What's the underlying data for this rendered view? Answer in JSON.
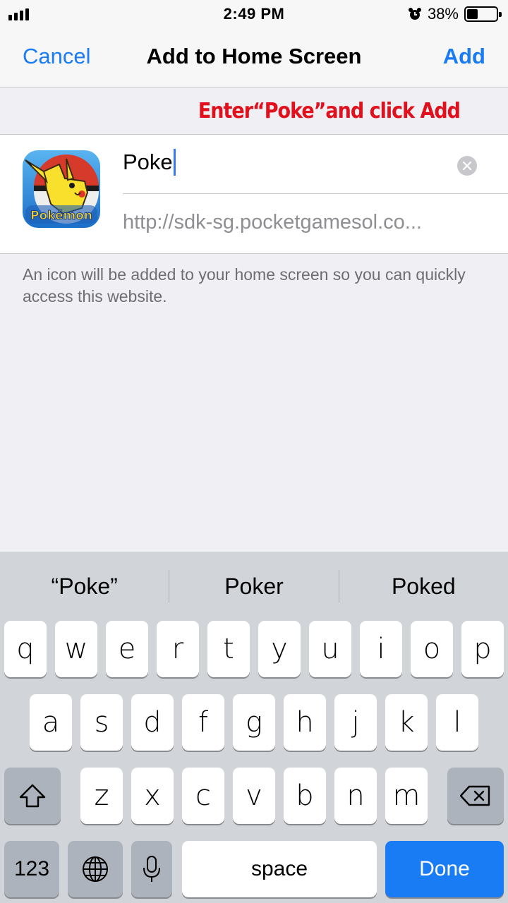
{
  "status_bar": {
    "time": "2:49 PM",
    "battery_percent": "38%",
    "battery_level": 0.38
  },
  "nav": {
    "cancel_label": "Cancel",
    "title": "Add to Home Screen",
    "add_label": "Add"
  },
  "annotation": "Enter“Poke”and click Add",
  "form": {
    "name_value": "Poke",
    "url": "http://sdk-sg.pocketgamesol.co...",
    "icon": "pokemon-pikachu-app-icon"
  },
  "footnote": "An icon will be added to your home screen so you can quickly access this website.",
  "keyboard": {
    "predictions": [
      "“Poke”",
      "Poker",
      "Poked"
    ],
    "row1": [
      "q",
      "w",
      "e",
      "r",
      "t",
      "y",
      "u",
      "i",
      "o",
      "p"
    ],
    "row2": [
      "a",
      "s",
      "d",
      "f",
      "g",
      "h",
      "j",
      "k",
      "l"
    ],
    "row3": [
      "z",
      "x",
      "c",
      "v",
      "b",
      "n",
      "m"
    ],
    "numbers_label": "123",
    "space_label": "space",
    "done_label": "Done",
    "accent_color": "#1a7cf5"
  }
}
